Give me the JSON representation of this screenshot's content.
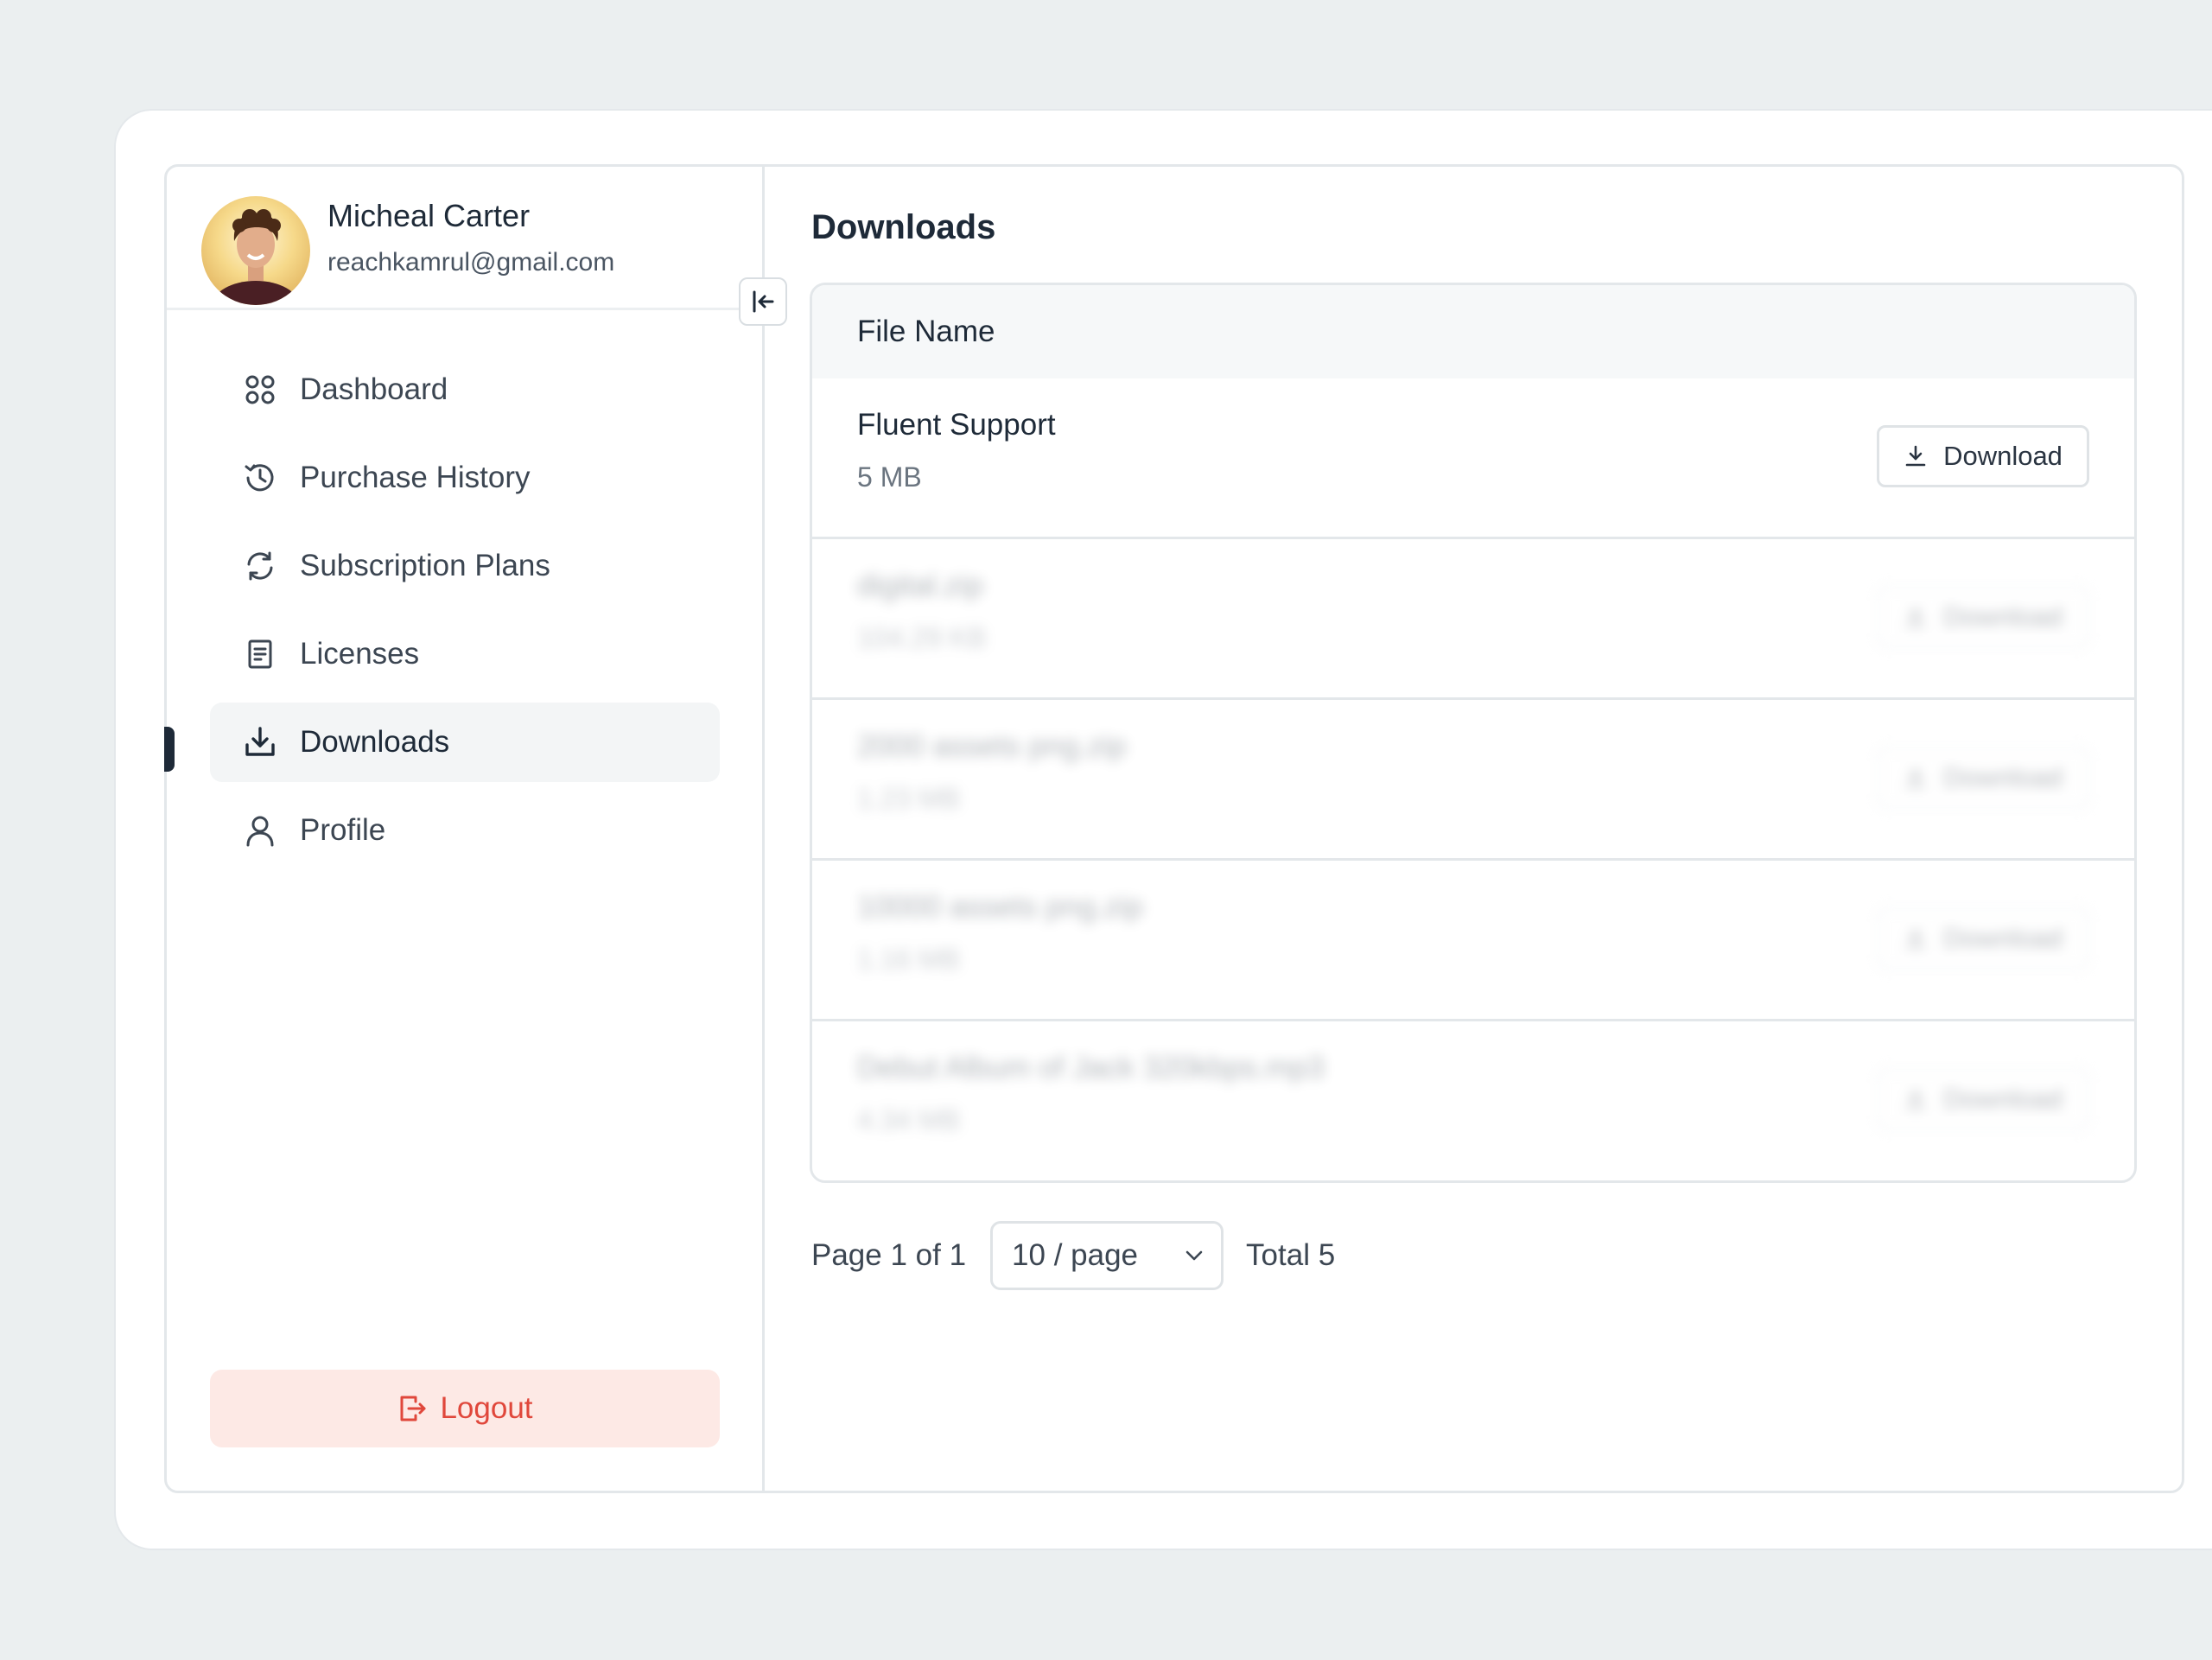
{
  "user": {
    "name": "Micheal Carter",
    "email": "reachkamrul@gmail.com"
  },
  "sidebar": {
    "items": [
      {
        "label": "Dashboard",
        "icon": "dashboard-grid-icon"
      },
      {
        "label": "Purchase History",
        "icon": "history-icon"
      },
      {
        "label": "Subscription Plans",
        "icon": "refresh-icon"
      },
      {
        "label": "Licenses",
        "icon": "document-icon"
      },
      {
        "label": "Downloads",
        "icon": "download-icon",
        "active": true
      },
      {
        "label": "Profile",
        "icon": "user-icon"
      }
    ],
    "logout_label": "Logout"
  },
  "main": {
    "title": "Downloads",
    "table": {
      "column_header": "File Name",
      "rows": [
        {
          "name": "Fluent Support",
          "size": "5 MB",
          "action": "Download"
        },
        {
          "name": "digital.zip",
          "size": "104.29 KB",
          "action": "Download"
        },
        {
          "name": "2000 assets png.zip",
          "size": "1.23 MB",
          "action": "Download"
        },
        {
          "name": "10000 assets png.zip",
          "size": "1.16 MB",
          "action": "Download"
        },
        {
          "name": "Debut Album of Jack 320kbps.mp3",
          "size": "4.34 MB",
          "action": "Download"
        }
      ]
    },
    "pagination": {
      "page_info": "Page 1 of 1",
      "page_size": "10 / page",
      "total": "Total 5"
    }
  },
  "colors": {
    "background": "#ebeff0",
    "accent_dark": "#1e2a38",
    "logout_bg": "#fde9e5",
    "logout_text": "#e0473b"
  }
}
